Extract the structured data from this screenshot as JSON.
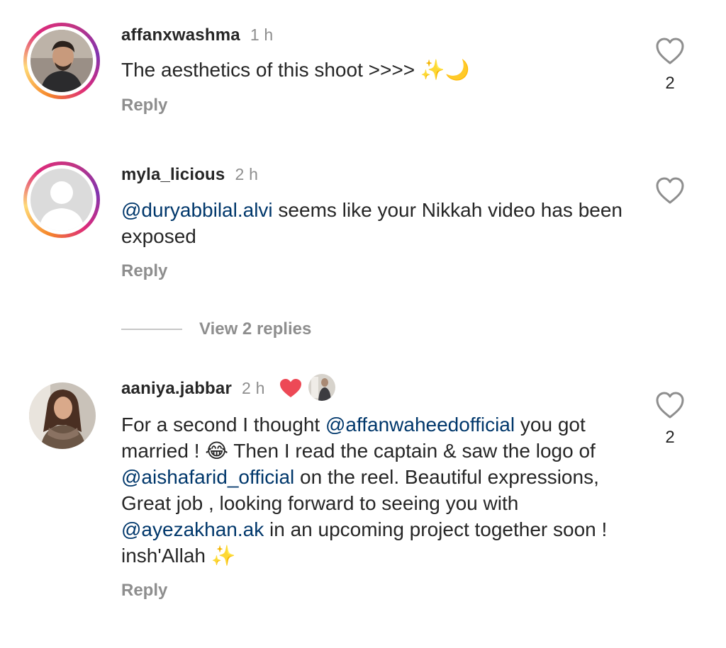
{
  "comments": [
    {
      "username": "affanxwashma",
      "time": "1 h",
      "text_parts": {
        "t1": "The aesthetics of this shoot >>>> ",
        "emoji": "✨🌙"
      },
      "reply_label": "Reply",
      "like_count": "2"
    },
    {
      "username": "myla_licious",
      "time": "2 h",
      "text_parts": {
        "mention1": "@duryabbilal.alvi",
        "t1": " seems like your Nikkah video has been exposed"
      },
      "reply_label": "Reply",
      "like_count": ""
    },
    {
      "username": "aaniya.jabbar",
      "time": "2 h",
      "text_parts": {
        "t1": "For a second I thought ",
        "mention1": "@affanwaheedofficial",
        "t2": " you got married ! ",
        "emoji1": "😂",
        "t3": " Then I read the captain & saw the logo of ",
        "mention2": "@aishafarid_official",
        "t4": " on the reel. Beautiful expressions, Great job , looking forward to seeing you with ",
        "mention3": "@ayezakhan.ak",
        "t5": " in an upcoming project together soon ! insh'Allah ",
        "emoji2": "✨"
      },
      "reply_label": "Reply",
      "like_count": "2"
    }
  ],
  "view_replies_label": "View 2 replies",
  "icons": {
    "heart_outline": "heart-outline-icon",
    "creator_heart": "red-heart-icon",
    "creator_avatar": "creator-avatar-icon"
  },
  "colors": {
    "text": "#262626",
    "muted": "#8e8e8e",
    "mention": "#00376b",
    "creator_heart": "#ed4956"
  }
}
